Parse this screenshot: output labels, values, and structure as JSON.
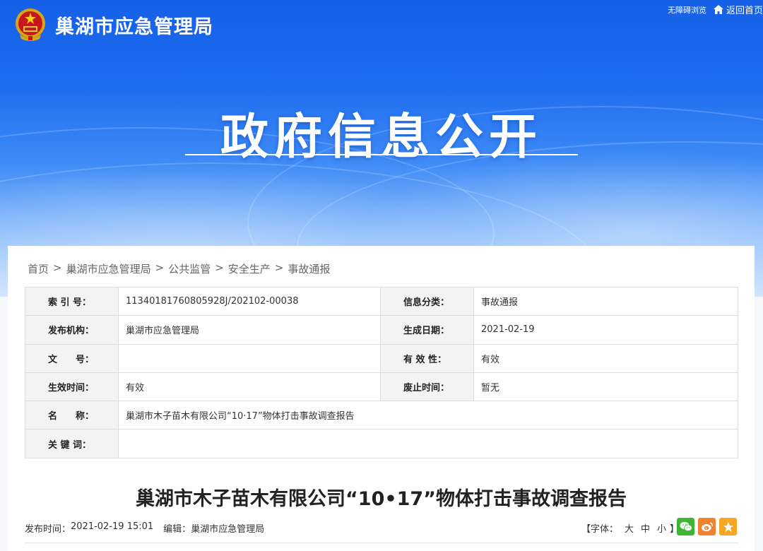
{
  "header": {
    "site_title": "巢湖市应急管理局",
    "accessibility_label": "无障碍浏览",
    "home_label": "返回首页"
  },
  "hero": {
    "title": "政府信息公开"
  },
  "breadcrumb": [
    "首页",
    "巢湖市应急管理局",
    "公共监管",
    "安全生产",
    "事故通报"
  ],
  "breadcrumb_sep": ">",
  "meta": {
    "index_label": "索 引 号：",
    "index_value": "11340181760805928J/202102-00038",
    "category_label": "信息分类：",
    "category_value": "事故通报",
    "publisher_label": "发布机构：",
    "publisher_value": "巢湖市应急管理局",
    "created_label": "生成日期：",
    "created_value": "2021-02-19",
    "docno_label": "文　　号：",
    "docno_value": "",
    "validity_label": "有 效 性：",
    "validity_value": "有效",
    "effective_label": "生效时间：",
    "effective_value": "有效",
    "repeal_label": "废止时间：",
    "repeal_value": "暂无",
    "name_label": "名　　称：",
    "name_value": "巢湖市木子苗木有限公司“10·17”物体打击事故调查报告",
    "keywords_label": "关 键 词：",
    "keywords_value": ""
  },
  "article": {
    "title": "巢湖市木子苗木有限公司“10•17”物体打击事故调查报告",
    "publish_label": "发布时间：",
    "publish_time": "2021-02-19 15:01",
    "editor_label": "编辑：",
    "editor_value": "巢湖市应急管理局",
    "font_prefix": "【字体：",
    "font_large": "大",
    "font_medium": "中",
    "font_small": "小",
    "font_suffix": "】"
  },
  "share": {
    "wechat_color": "#3fb534",
    "weibo_color": "#f2822f",
    "favorite_color": "#f5a623"
  }
}
